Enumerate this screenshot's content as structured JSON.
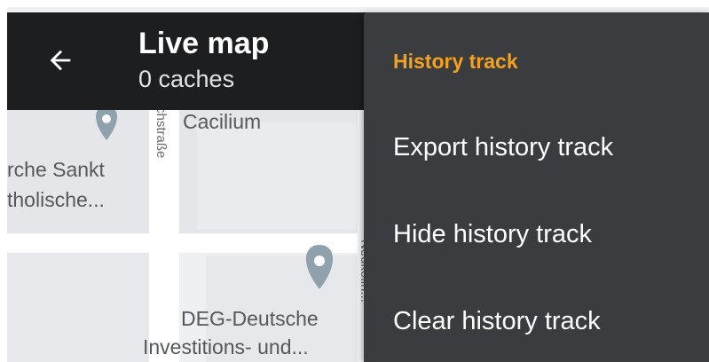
{
  "appbar": {
    "back_icon": "arrow-back-icon",
    "title": "Live map",
    "subtitle": "0 caches"
  },
  "map": {
    "labels": {
      "cacilium": "Cacilium",
      "church_line1": "rche Sankt",
      "church_line2": "tholische...",
      "deg_line1": "DEG-Deutsche",
      "deg_line2": "Investitions- und...",
      "street_left": "chstraße",
      "street_right": "Neukölln..."
    },
    "pin_icon": "map-pin-icon",
    "colors": {
      "pin": "#8fa1ac",
      "background": "#eef0f2",
      "roads": "#ffffff"
    }
  },
  "menu": {
    "header": "History track",
    "header_color": "#f5a21b",
    "items": [
      {
        "label": "Export history track"
      },
      {
        "label": "Hide history track"
      },
      {
        "label": "Clear history track"
      }
    ],
    "background": "#3a3c3f"
  }
}
